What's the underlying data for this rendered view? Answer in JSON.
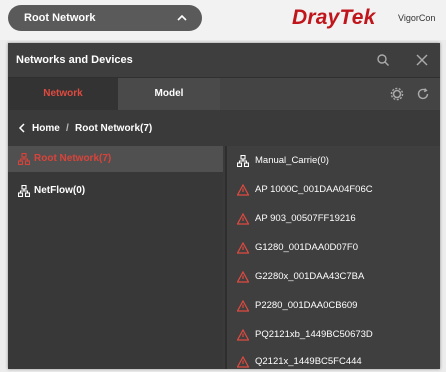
{
  "top": {
    "network_select": "Root Network",
    "brand": "DrayTek",
    "brand_sub": "VigorCon"
  },
  "panel": {
    "title": "Networks and Devices",
    "tabs": [
      "Network",
      "Model"
    ],
    "breadcrumb": {
      "home": "Home",
      "separator": "/",
      "current": "Root Network(7)"
    }
  },
  "left_list": [
    {
      "label": "Root Network(7)",
      "icon": "network-icon",
      "selected": true
    },
    {
      "label": "NetFlow(0)",
      "icon": "network-icon",
      "selected": false
    }
  ],
  "right_list": [
    {
      "label": "Manual_Carrie(0)",
      "icon": "network-icon"
    },
    {
      "label": "AP 1000C_001DAA04F06C",
      "icon": "warning-icon"
    },
    {
      "label": "AP 903_00507FF19216",
      "icon": "warning-icon"
    },
    {
      "label": "G1280_001DAA0D07F0",
      "icon": "warning-icon"
    },
    {
      "label": "G2280x_001DAA43C7BA",
      "icon": "warning-icon"
    },
    {
      "label": "P2280_001DAA0CB609",
      "icon": "warning-icon"
    },
    {
      "label": "PQ2121xb_1449BC50673D",
      "icon": "warning-icon"
    },
    {
      "label": "Q2121x_1449BC5FC444",
      "icon": "warning-icon"
    }
  ],
  "colors": {
    "accent": "#e04a40",
    "panel": "#3a3a3a",
    "brand_red": "#c0151b"
  }
}
